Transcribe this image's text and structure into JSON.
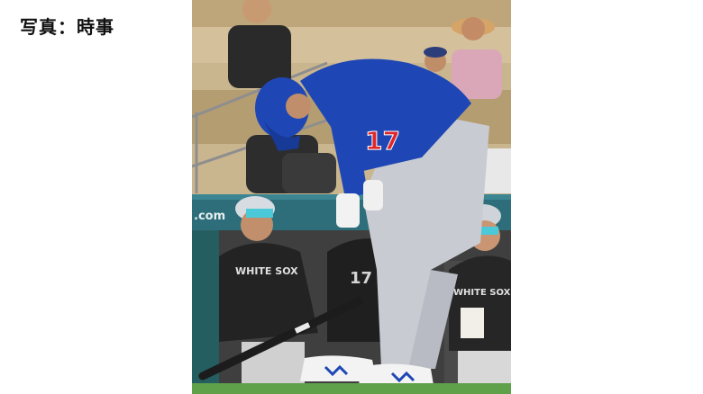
{
  "credit": {
    "text": "写真：時事"
  },
  "photo": {
    "subject": "baseball-batter-in-blue-jersey",
    "jersey_number": "17",
    "jersey_color": "#1e47b5",
    "pants_color": "#c9cbd3",
    "jersey_number_color": "#e0262a",
    "dugout_shirt_labels": [
      "WHITE SOX",
      "WHITE SOX"
    ],
    "wall_text": ".com"
  }
}
